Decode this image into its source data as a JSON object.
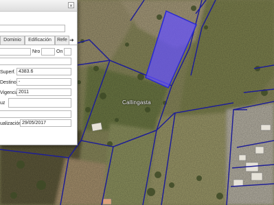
{
  "map": {
    "place_label": "Callingasta",
    "watermark": "C",
    "colors": {
      "boundary": "#1e1e96",
      "selected_fill": "#6450ff",
      "farmland": "#8e8c5e",
      "scrub": "#7a7d4e"
    }
  },
  "panel": {
    "close_icon": "×",
    "tabs": [
      {
        "label": "Dominio"
      },
      {
        "label": "Edificación"
      },
      {
        "label": "Refe"
      }
    ],
    "tab_scroll_icon": "➜",
    "fields": {
      "nro_label": "Nro",
      "on_label": "On",
      "superficie_label": "Superf.",
      "superficie_value": "4383.6",
      "destino_label": "Destino",
      "destino_value": "-",
      "vigencia_label": "Vigencia",
      "vigencia_value": "2011",
      "uz_label": "uz",
      "actualizacion_label": "ualización",
      "actualizacion_value": "29/05/2017"
    }
  }
}
